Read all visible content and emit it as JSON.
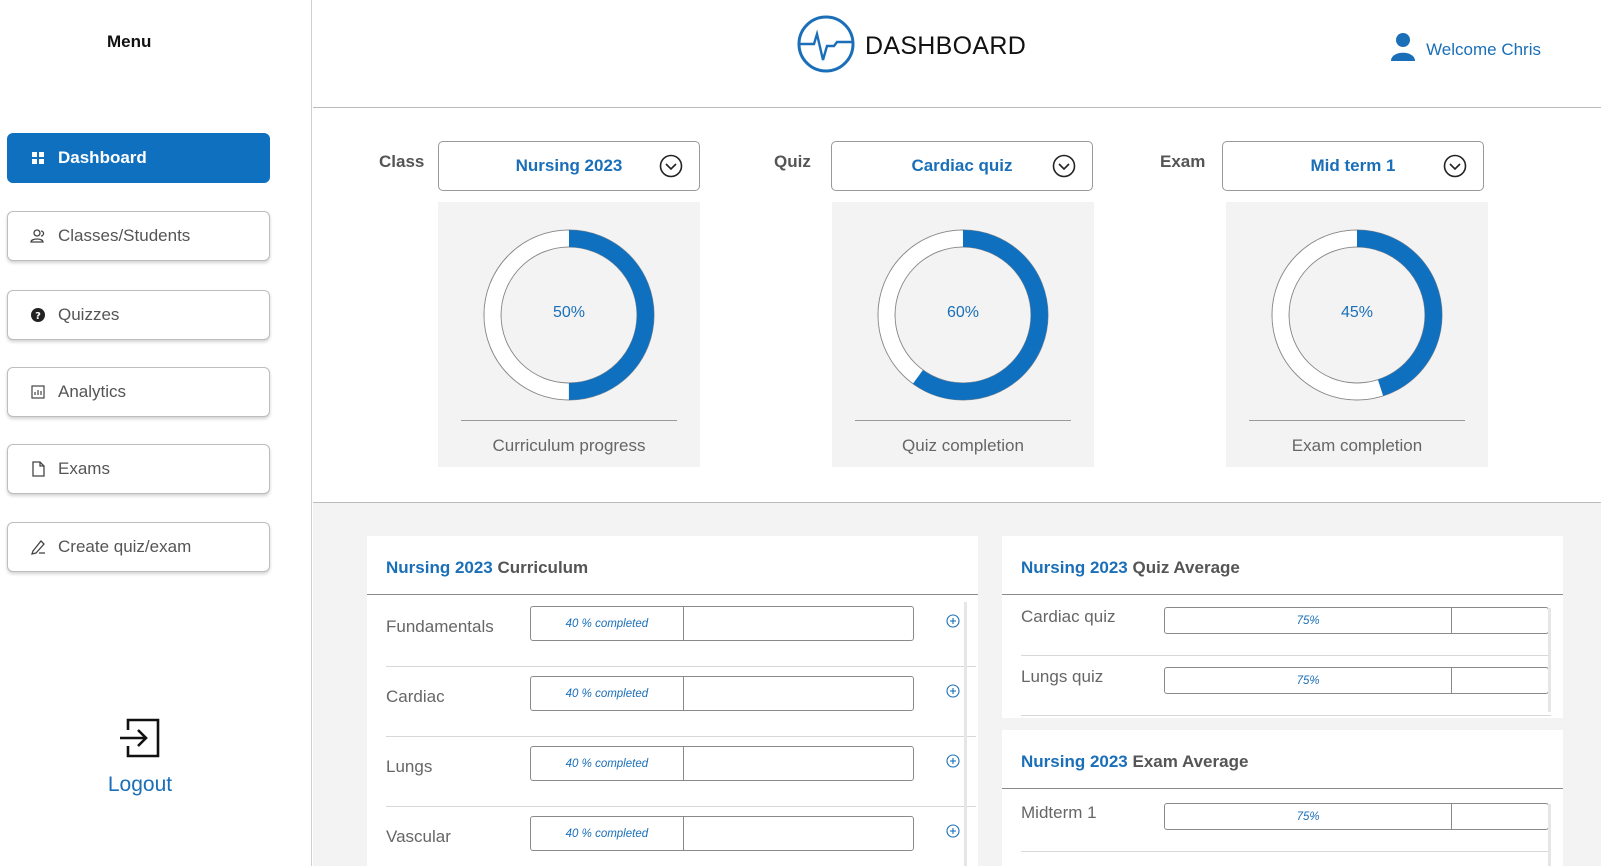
{
  "sidebar": {
    "menu_title": "Menu",
    "items": [
      {
        "label": "Dashboard",
        "icon": "grid-icon",
        "active": true
      },
      {
        "label": "Classes/Students",
        "icon": "users-icon",
        "active": false
      },
      {
        "label": "Quizzes",
        "icon": "question-icon",
        "active": false
      },
      {
        "label": "Analytics",
        "icon": "bar-chart-icon",
        "active": false
      },
      {
        "label": "Exams",
        "icon": "document-icon",
        "active": false
      },
      {
        "label": "Create quiz/exam",
        "icon": "pen-icon",
        "active": false
      }
    ],
    "logout_label": "Logout"
  },
  "header": {
    "title": "DASHBOARD",
    "welcome": "Welcome Chris"
  },
  "selectors": [
    {
      "label": "Class",
      "value": "Nursing 2023",
      "percent": 50,
      "percent_text": "50%",
      "caption": "Curriculum progress"
    },
    {
      "label": "Quiz",
      "value": "Cardiac quiz",
      "percent": 60,
      "percent_text": "60%",
      "caption": "Quiz completion"
    },
    {
      "label": "Exam",
      "value": "Mid term 1",
      "percent": 45,
      "percent_text": "45%",
      "caption": "Exam completion"
    }
  ],
  "curriculum": {
    "title_accent": "Nursing 2023",
    "title_rest": " Curriculum",
    "rows": [
      {
        "label": "Fundamentals",
        "status": "40 % completed",
        "progress": 0.4
      },
      {
        "label": "Cardiac",
        "status": "40 % completed",
        "progress": 0.4
      },
      {
        "label": "Lungs",
        "status": "40 % completed",
        "progress": 0.4
      },
      {
        "label": "Vascular",
        "status": "40 % completed",
        "progress": 0.4
      }
    ]
  },
  "quiz_average": {
    "title_accent": "Nursing 2023",
    "title_rest": " Quiz Average",
    "rows": [
      {
        "label": "Cardiac quiz",
        "value": "75%",
        "progress": 0.75
      },
      {
        "label": "Lungs quiz",
        "value": "75%",
        "progress": 0.75
      }
    ]
  },
  "exam_average": {
    "title_accent": "Nursing 2023",
    "title_rest": " Exam Average",
    "rows": [
      {
        "label": "Midterm 1",
        "value": "75%",
        "progress": 0.75
      }
    ]
  },
  "colors": {
    "accent": "#1070c0",
    "text_blue": "#1a6fb8",
    "donut_track": "#ffffff",
    "card_bg": "#f3f3f3"
  }
}
